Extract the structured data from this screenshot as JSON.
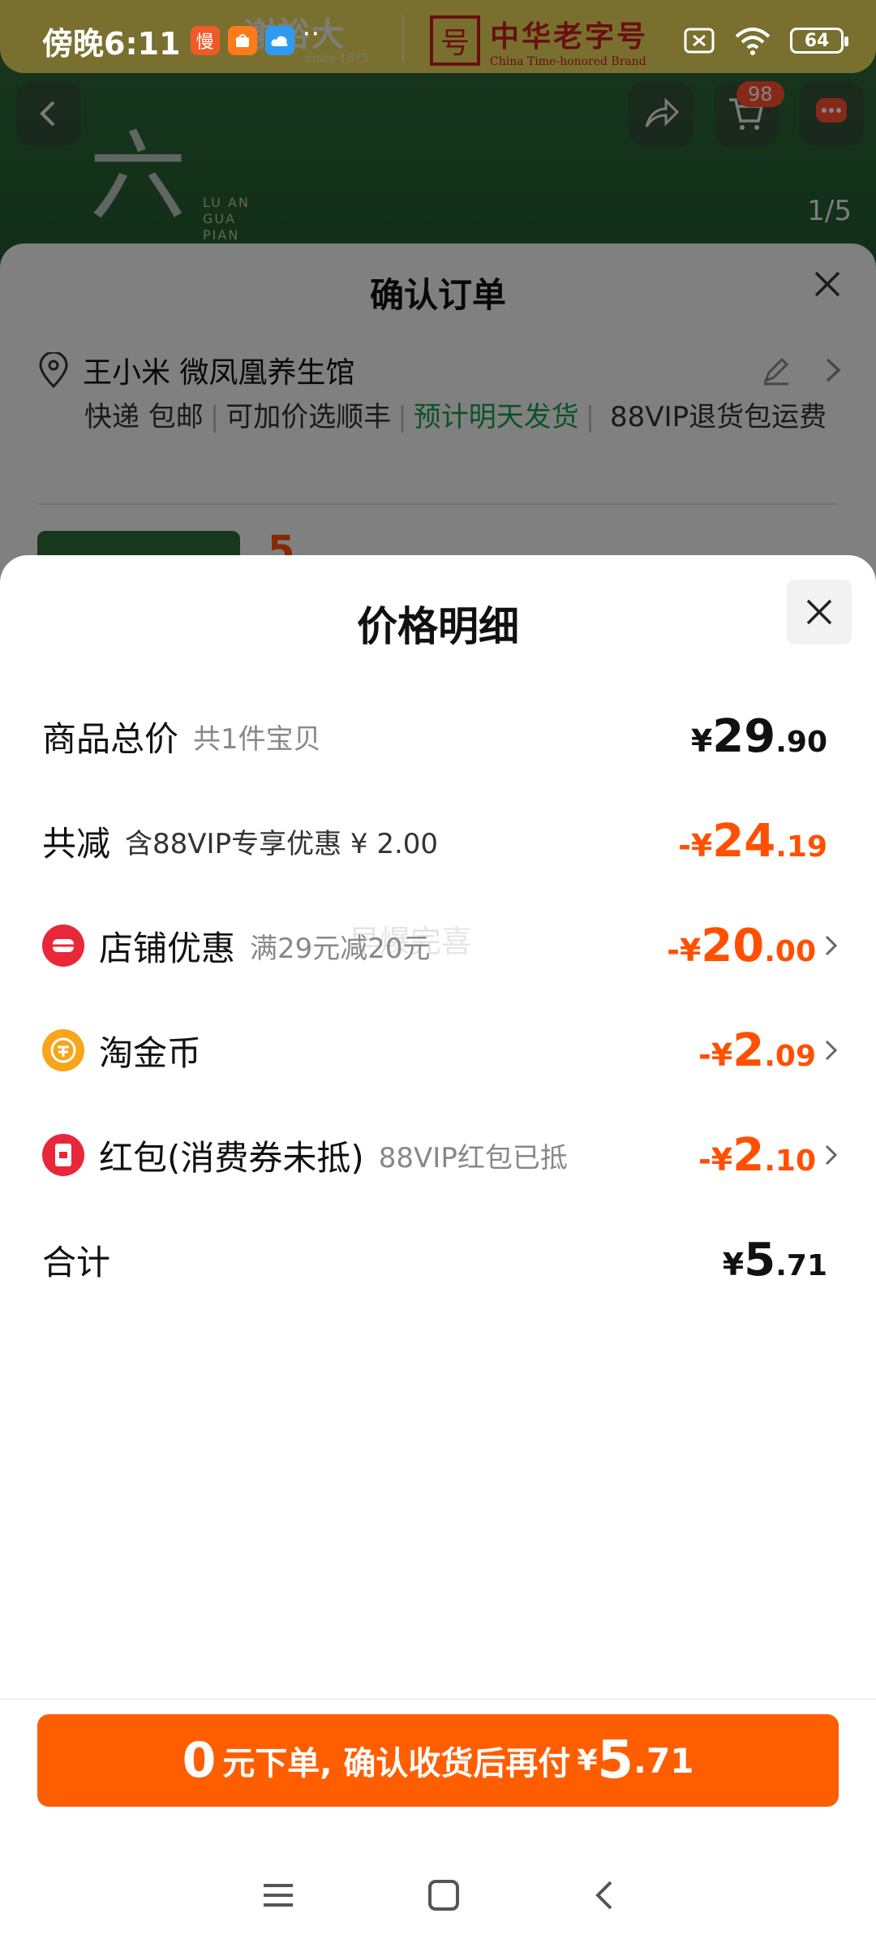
{
  "status_bar": {
    "time": "傍晚6:11",
    "battery": "64",
    "apps": [
      "慢",
      "",
      ""
    ]
  },
  "banner": {
    "logo_text": "谢裕大",
    "logo_sub": "Since 1875",
    "brand_seal": "号",
    "brand_cn": "中华老字号",
    "brand_en": "China Time-honored Brand",
    "big_char": "六",
    "latin_text": "LU AN\nGUA\nPIAN",
    "image_counter": "1/5",
    "cart_badge": "98"
  },
  "order_sheet": {
    "title": "确认订单",
    "address_name": "王小米 微凤凰养生馆",
    "ship_express": "快递 包邮",
    "ship_sf": "可加价选顺丰",
    "ship_eta": "预计明天发货",
    "ship_return": "88VIP退货包运费",
    "peek_text": "5"
  },
  "price_detail": {
    "title": "价格明细",
    "watermark": "早爆完喜",
    "rows": [
      {
        "label": "商品总价",
        "note": "共1件宝贝",
        "currency": "¥",
        "int": "29",
        "dec": ".90"
      },
      {
        "label": "共减",
        "note": "含88VIP专享优惠 ¥ 2.00",
        "currency": "-¥",
        "int": "24",
        "dec": ".19"
      },
      {
        "label": "店铺优惠",
        "note": "满29元减20元",
        "currency": "-¥",
        "int": "20",
        "dec": ".00"
      },
      {
        "label": "淘金币",
        "note": "",
        "currency": "-¥",
        "int": "2",
        "dec": ".09"
      },
      {
        "label": "红包(消费券未抵)",
        "note": "88VIP红包已抵",
        "currency": "-¥",
        "int": "2",
        "dec": ".10"
      },
      {
        "label": "合计",
        "note": "",
        "currency": "¥",
        "int": "5",
        "dec": ".71"
      }
    ]
  },
  "pay_button": {
    "big": "0",
    "text": "元下单, 确认收货后再付",
    "currency": "¥",
    "int": "5",
    "dec": ".71"
  },
  "colors": {
    "accent_orange": "#ff5000",
    "button_orange": "#ff5e00",
    "green": "#1a9e4d"
  }
}
